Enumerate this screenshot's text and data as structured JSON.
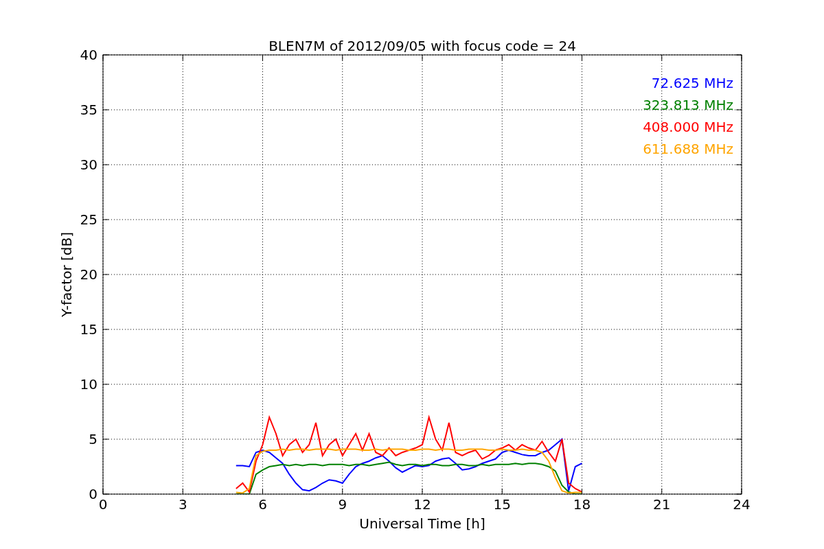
{
  "figure": {
    "chart_data": {
      "type": "line",
      "title": "BLEN7M of 2012/09/05 with focus code = 24",
      "xlabel": "Universal Time [h]",
      "ylabel": "Y-factor [dB]",
      "x": [
        5.0,
        5.25,
        5.5,
        5.75,
        6.0,
        6.25,
        6.5,
        6.75,
        7.0,
        7.25,
        7.5,
        7.75,
        8.0,
        8.25,
        8.5,
        8.75,
        9.0,
        9.25,
        9.5,
        9.75,
        10.0,
        10.25,
        10.5,
        10.75,
        11.0,
        11.25,
        11.5,
        11.75,
        12.0,
        12.25,
        12.5,
        12.75,
        13.0,
        13.25,
        13.5,
        13.75,
        14.0,
        14.25,
        14.5,
        14.75,
        15.0,
        15.25,
        15.5,
        15.75,
        16.0,
        16.25,
        16.5,
        16.75,
        17.0,
        17.25,
        17.5,
        17.75,
        18.0
      ],
      "series": [
        {
          "name": "72.625 MHz",
          "color": "#0000ff",
          "values": [
            2.6,
            2.6,
            2.5,
            3.8,
            4.0,
            3.8,
            3.3,
            2.8,
            1.8,
            1.0,
            0.4,
            0.3,
            0.6,
            1.0,
            1.3,
            1.2,
            1.0,
            1.8,
            2.5,
            2.8,
            3.0,
            3.3,
            3.5,
            3.0,
            2.4,
            2.0,
            2.3,
            2.6,
            2.5,
            2.6,
            3.0,
            3.2,
            3.3,
            2.8,
            2.2,
            2.3,
            2.5,
            2.8,
            3.0,
            3.2,
            3.8,
            4.0,
            3.8,
            3.6,
            3.5,
            3.5,
            3.8,
            4.0,
            4.5,
            5.0,
            0.3,
            2.5,
            2.8
          ]
        },
        {
          "name": "323.813 MHz",
          "color": "#008000",
          "values": [
            0,
            0,
            0,
            1.8,
            2.2,
            2.5,
            2.6,
            2.7,
            2.6,
            2.7,
            2.6,
            2.7,
            2.7,
            2.6,
            2.7,
            2.7,
            2.7,
            2.6,
            2.7,
            2.7,
            2.6,
            2.7,
            2.8,
            2.9,
            2.7,
            2.6,
            2.7,
            2.7,
            2.6,
            2.7,
            2.7,
            2.6,
            2.6,
            2.7,
            2.7,
            2.6,
            2.6,
            2.7,
            2.6,
            2.7,
            2.7,
            2.7,
            2.8,
            2.7,
            2.8,
            2.8,
            2.7,
            2.5,
            2.1,
            0.8,
            0.2,
            0,
            0
          ]
        },
        {
          "name": "408.000 MHz",
          "color": "#ff0000",
          "values": [
            0.5,
            1.0,
            0.2,
            3.0,
            4.5,
            7.0,
            5.5,
            3.5,
            4.5,
            5.0,
            3.8,
            4.5,
            6.5,
            3.5,
            4.5,
            5.0,
            3.5,
            4.5,
            5.5,
            4.0,
            5.5,
            3.8,
            3.5,
            4.2,
            3.5,
            3.8,
            4.0,
            4.2,
            4.5,
            7.0,
            5.0,
            4.0,
            6.5,
            3.8,
            3.5,
            3.8,
            4.0,
            3.2,
            3.5,
            4.0,
            4.2,
            4.5,
            4.0,
            4.5,
            4.2,
            4.0,
            4.8,
            3.8,
            3.0,
            5.0,
            1.0,
            0.5,
            0.2
          ]
        },
        {
          "name": "611.688 MHz",
          "color": "#ffa500",
          "values": [
            0.15,
            0.1,
            0.5,
            3.5,
            3.9,
            4.0,
            4.0,
            4.1,
            4.0,
            4.1,
            4.1,
            4.0,
            4.1,
            4.1,
            4.1,
            4.0,
            4.1,
            4.1,
            4.1,
            4.0,
            4.0,
            4.1,
            4.0,
            4.1,
            4.1,
            4.1,
            4.0,
            4.0,
            4.1,
            4.1,
            4.0,
            4.1,
            4.1,
            4.0,
            4.0,
            4.1,
            4.1,
            4.1,
            4.0,
            4.0,
            4.1,
            4.0,
            4.0,
            4.1,
            4.0,
            4.0,
            3.8,
            3.0,
            1.5,
            0.3,
            0.1,
            0.15,
            0.15
          ]
        }
      ],
      "grid": true,
      "xlim": [
        0,
        24
      ],
      "ylim": [
        0,
        40
      ],
      "xticks": [
        0,
        3,
        6,
        9,
        12,
        15,
        18,
        21,
        24
      ],
      "yticks": [
        0,
        5,
        10,
        15,
        20,
        25,
        30,
        35,
        40
      ]
    }
  }
}
